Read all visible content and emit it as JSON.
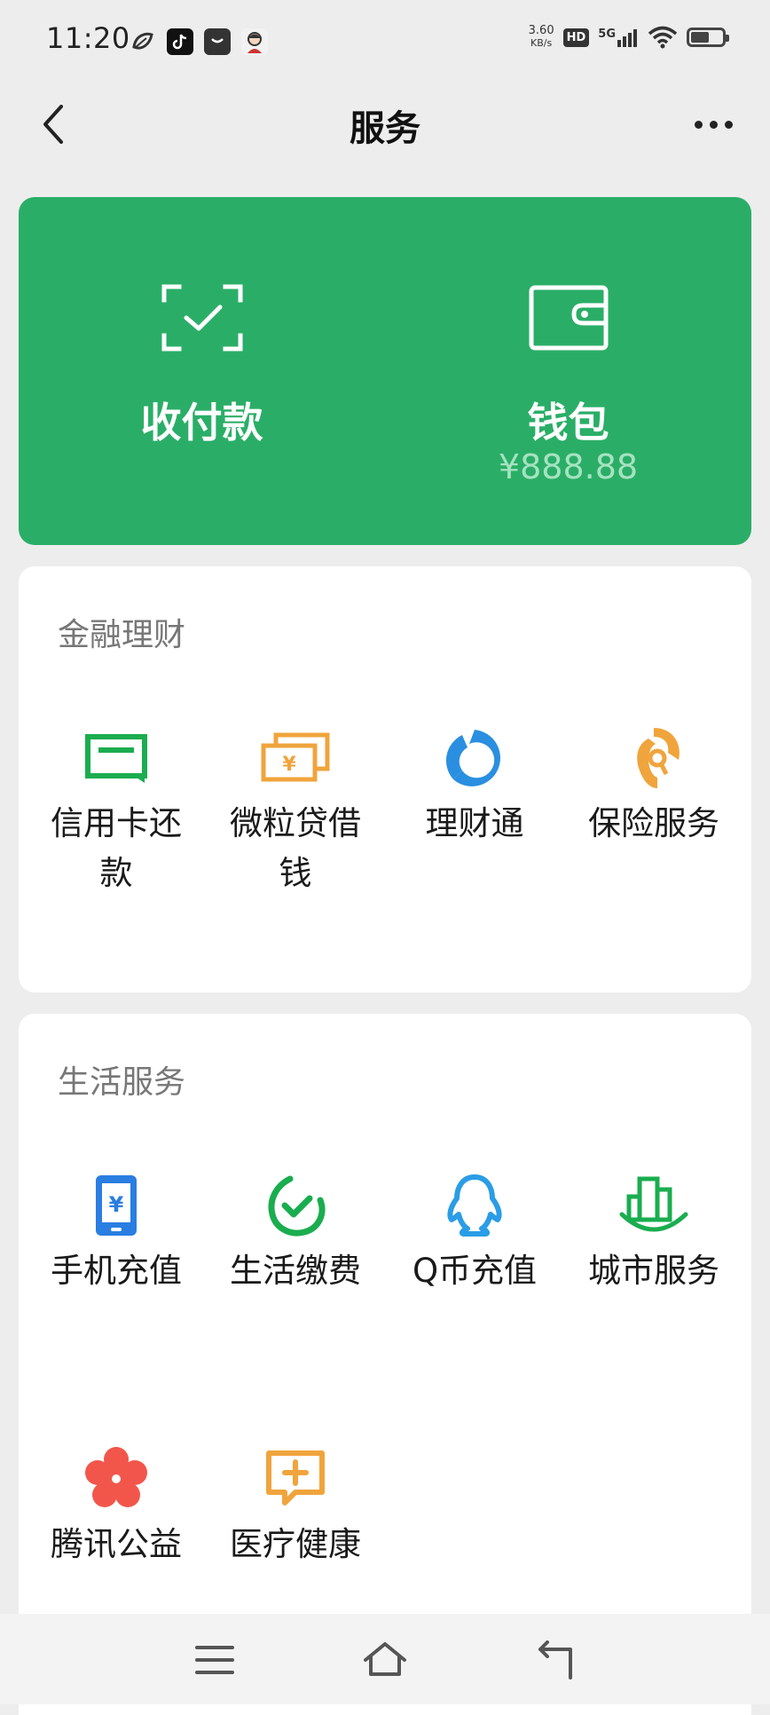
{
  "status_bar": {
    "time": "11:20",
    "speed_value": "3.60",
    "speed_unit": "KB/s",
    "hd_label": "HD",
    "network_label": "5G",
    "battery_level_percent": 60
  },
  "nav": {
    "title": "服务"
  },
  "wallet_card": {
    "background_color": "#2aae67",
    "pay_label": "收付款",
    "wallet_label": "钱包",
    "wallet_balance": "¥888.88"
  },
  "finance": {
    "title": "金融理财",
    "items": [
      {
        "label": "信用卡还款",
        "icon": "credit-card-icon",
        "color": "#1aad4f"
      },
      {
        "label": "微粒贷借钱",
        "icon": "loan-money-icon",
        "color": "#f0a43c"
      },
      {
        "label": "理财通",
        "icon": "licaitong-icon",
        "color": "#2a8fe0"
      },
      {
        "label": "保险服务",
        "icon": "insurance-icon",
        "color": "#f0a43c"
      }
    ]
  },
  "life": {
    "title": "生活服务",
    "items": [
      {
        "label": "手机充值",
        "icon": "phone-topup-icon",
        "color": "#2a7de1"
      },
      {
        "label": "生活缴费",
        "icon": "utility-pay-icon",
        "color": "#1aad4f"
      },
      {
        "label": "Q币充值",
        "icon": "qq-penguin-icon",
        "color": "#2a9de6"
      },
      {
        "label": "城市服务",
        "icon": "city-service-icon",
        "color": "#1aad4f"
      },
      {
        "label": "腾讯公益",
        "icon": "charity-flower-icon",
        "color": "#f2564b"
      },
      {
        "label": "医疗健康",
        "icon": "medical-health-icon",
        "color": "#f0a43c"
      }
    ]
  }
}
